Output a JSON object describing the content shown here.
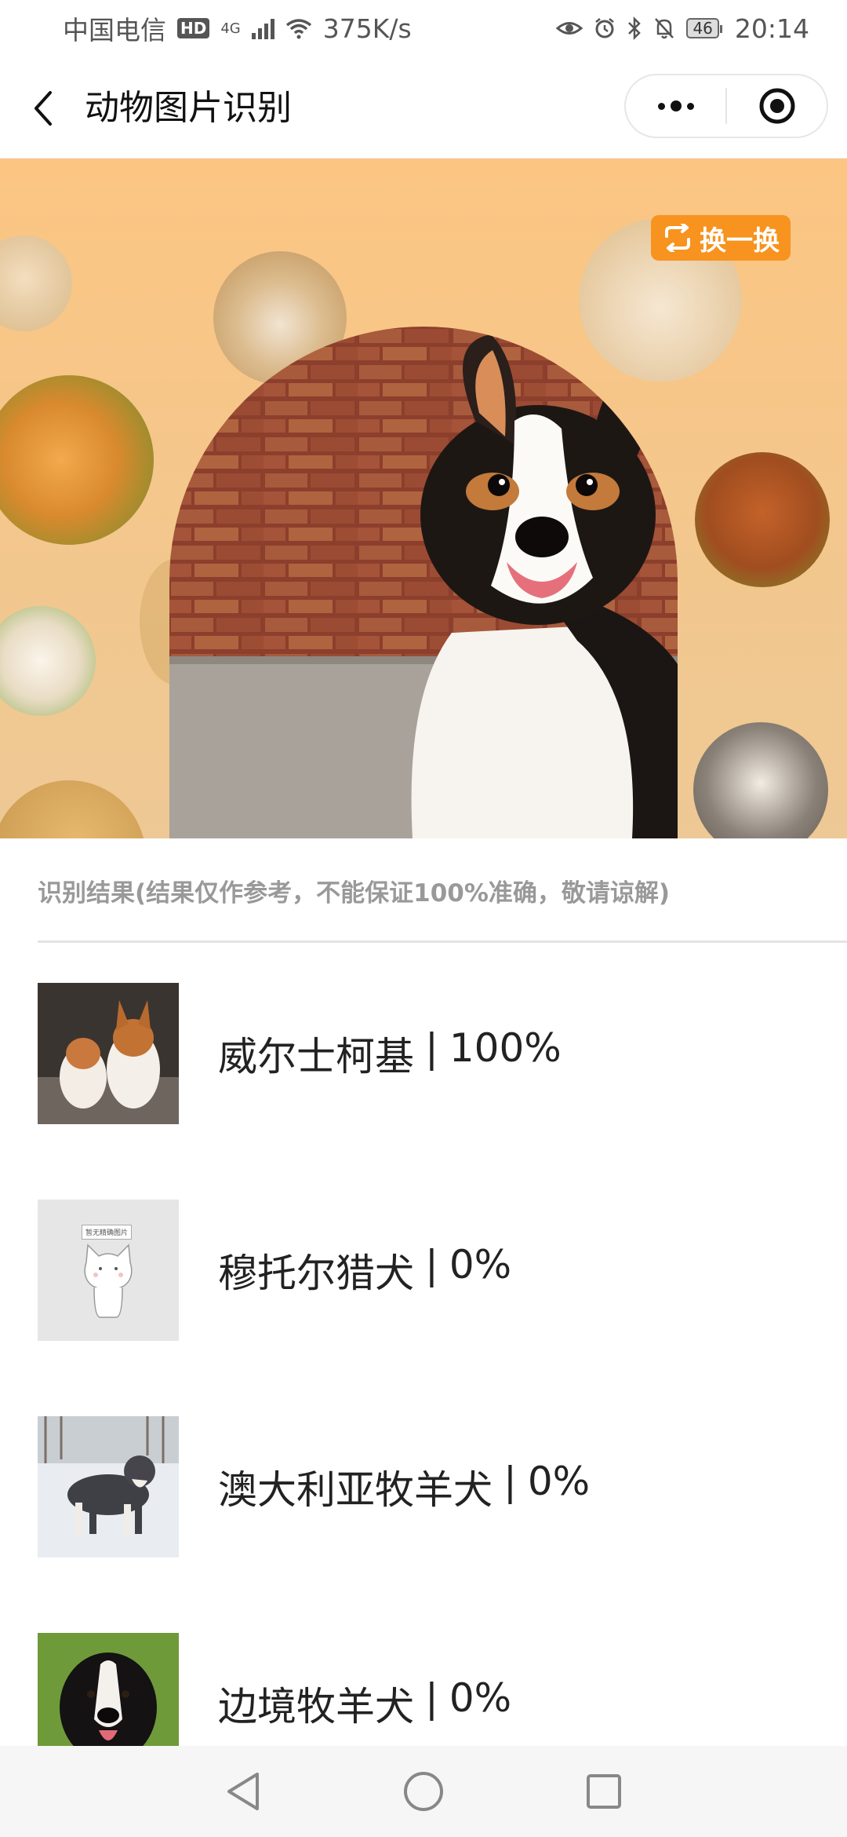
{
  "status_bar": {
    "carrier": "中国电信",
    "hd_badge": "HD",
    "network": "4G",
    "speed": "375K/s",
    "battery": "46",
    "time": "20:14"
  },
  "header": {
    "title": "动物图片识别",
    "icons": [
      "back-icon",
      "more-icon",
      "close-miniprogram-icon"
    ]
  },
  "hero": {
    "swap_label": "换一换",
    "accent_color": "#f7931e"
  },
  "results": {
    "header": "识别结果(结果仅作参考，不能保证100%准确，敬请谅解)",
    "items": [
      {
        "name": "威尔士柯基",
        "sep": "|",
        "score": "100%"
      },
      {
        "name": "穆托尔猎犬",
        "sep": "|",
        "score": "0%"
      },
      {
        "name": "澳大利亚牧羊犬",
        "sep": "|",
        "score": "0%"
      },
      {
        "name": "边境牧羊犬",
        "sep": "|",
        "score": "0%"
      }
    ],
    "placeholder_caption": "暂无精确图片"
  }
}
